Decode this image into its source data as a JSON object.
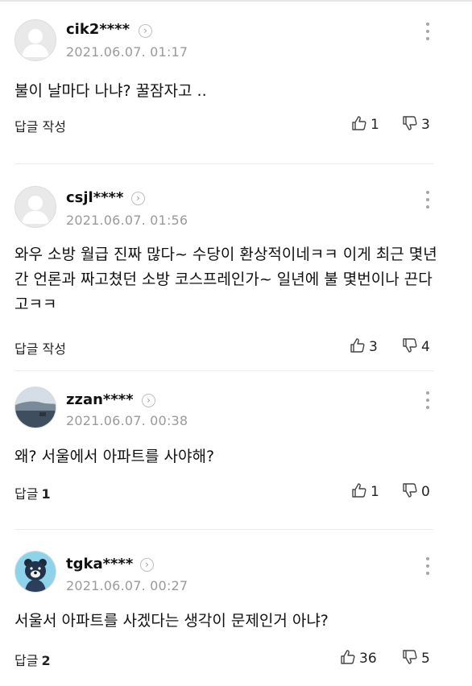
{
  "comments": [
    {
      "username": "cik2****",
      "date": "2021.06.07. 01:17",
      "text": "불이 날마다 나냐? 꿀잠자고 ..",
      "reply_label": "답글 작성",
      "reply_count": "",
      "likes": "1",
      "dislikes": "3",
      "avatar_icon": "default-profile-icon"
    },
    {
      "username": "csjl****",
      "date": "2021.06.07. 01:56",
      "text": "와우 소방 월급 진짜 많다~ 수당이 환상적이네ㅋㅋ 이게 최근 몇년간 언론과 짜고쳤던 소방 코스프레인가~ 일년에 불 몇번이나 끈다고ㅋㅋ",
      "reply_label": "답글 작성",
      "reply_count": "",
      "likes": "3",
      "dislikes": "4",
      "avatar_icon": "default-profile-icon"
    },
    {
      "username": "zzan****",
      "date": "2021.06.07. 00:38",
      "text": "왜? 서울에서 아파트를 사야해?",
      "reply_label": "답글",
      "reply_count": "1",
      "likes": "1",
      "dislikes": "0",
      "avatar_icon": "landscape-photo-avatar"
    },
    {
      "username": "tgka****",
      "date": "2021.06.07. 00:27",
      "text": "서울서 아파트를 사겠다는 생각이 문제인거 아냐?",
      "reply_label": "답글",
      "reply_count": "2",
      "likes": "36",
      "dislikes": "5",
      "avatar_icon": "bear-character-avatar"
    }
  ]
}
